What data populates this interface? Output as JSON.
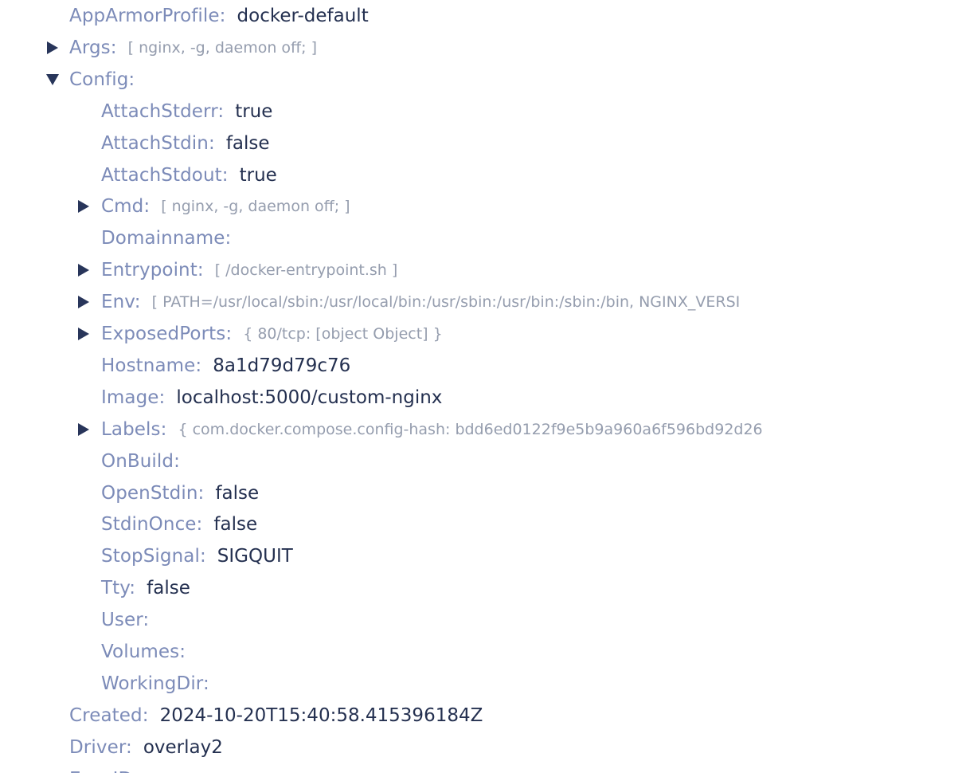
{
  "colors": {
    "key": "#7c8bb8",
    "value": "#243050",
    "preview": "#959dae",
    "caret": "#28355a",
    "background": "#ffffff"
  },
  "rows": [
    {
      "level": 0,
      "caret": "none",
      "key": "AppArmorProfile:",
      "value": "docker-default",
      "kind": "value"
    },
    {
      "level": 0,
      "caret": "collapsed",
      "key": "Args:",
      "value": "[ nginx, -g, daemon off; ]",
      "kind": "preview"
    },
    {
      "level": 0,
      "caret": "expanded",
      "key": "Config:",
      "value": "",
      "kind": "value"
    },
    {
      "level": 1,
      "caret": "none",
      "key": "AttachStderr:",
      "value": "true",
      "kind": "value"
    },
    {
      "level": 1,
      "caret": "none",
      "key": "AttachStdin:",
      "value": "false",
      "kind": "value"
    },
    {
      "level": 1,
      "caret": "none",
      "key": "AttachStdout:",
      "value": "true",
      "kind": "value"
    },
    {
      "level": 1,
      "caret": "collapsed",
      "key": "Cmd:",
      "value": "[ nginx, -g, daemon off; ]",
      "kind": "preview"
    },
    {
      "level": 1,
      "caret": "none",
      "key": "Domainname:",
      "value": "",
      "kind": "value"
    },
    {
      "level": 1,
      "caret": "collapsed",
      "key": "Entrypoint:",
      "value": "[ /docker-entrypoint.sh ]",
      "kind": "preview"
    },
    {
      "level": 1,
      "caret": "collapsed",
      "key": "Env:",
      "value": "[ PATH=/usr/local/sbin:/usr/local/bin:/usr/sbin:/usr/bin:/sbin:/bin, NGINX_VERSI",
      "kind": "preview"
    },
    {
      "level": 1,
      "caret": "collapsed",
      "key": "ExposedPorts:",
      "value": "{ 80/tcp: [object Object] }",
      "kind": "preview"
    },
    {
      "level": 1,
      "caret": "none",
      "key": "Hostname:",
      "value": "8a1d79d79c76",
      "kind": "value"
    },
    {
      "level": 1,
      "caret": "none",
      "key": "Image:",
      "value": "localhost:5000/custom-nginx",
      "kind": "value"
    },
    {
      "level": 1,
      "caret": "collapsed",
      "key": "Labels:",
      "value": "{ com.docker.compose.config-hash: bdd6ed0122f9e5b9a960a6f596bd92d26",
      "kind": "preview"
    },
    {
      "level": 1,
      "caret": "none",
      "key": "OnBuild:",
      "value": "",
      "kind": "value"
    },
    {
      "level": 1,
      "caret": "none",
      "key": "OpenStdin:",
      "value": "false",
      "kind": "value"
    },
    {
      "level": 1,
      "caret": "none",
      "key": "StdinOnce:",
      "value": "false",
      "kind": "value"
    },
    {
      "level": 1,
      "caret": "none",
      "key": "StopSignal:",
      "value": "SIGQUIT",
      "kind": "value"
    },
    {
      "level": 1,
      "caret": "none",
      "key": "Tty:",
      "value": "false",
      "kind": "value"
    },
    {
      "level": 1,
      "caret": "none",
      "key": "User:",
      "value": "",
      "kind": "value"
    },
    {
      "level": 1,
      "caret": "none",
      "key": "Volumes:",
      "value": "",
      "kind": "value"
    },
    {
      "level": 1,
      "caret": "none",
      "key": "WorkingDir:",
      "value": "",
      "kind": "value"
    },
    {
      "level": 0,
      "caret": "none",
      "key": "Created:",
      "value": "2024-10-20T15:40:58.415396184Z",
      "kind": "value"
    },
    {
      "level": 0,
      "caret": "none",
      "key": "Driver:",
      "value": "overlay2",
      "kind": "value"
    },
    {
      "level": 0,
      "caret": "none",
      "key": "ExecIDs:",
      "value": "",
      "kind": "value"
    }
  ]
}
